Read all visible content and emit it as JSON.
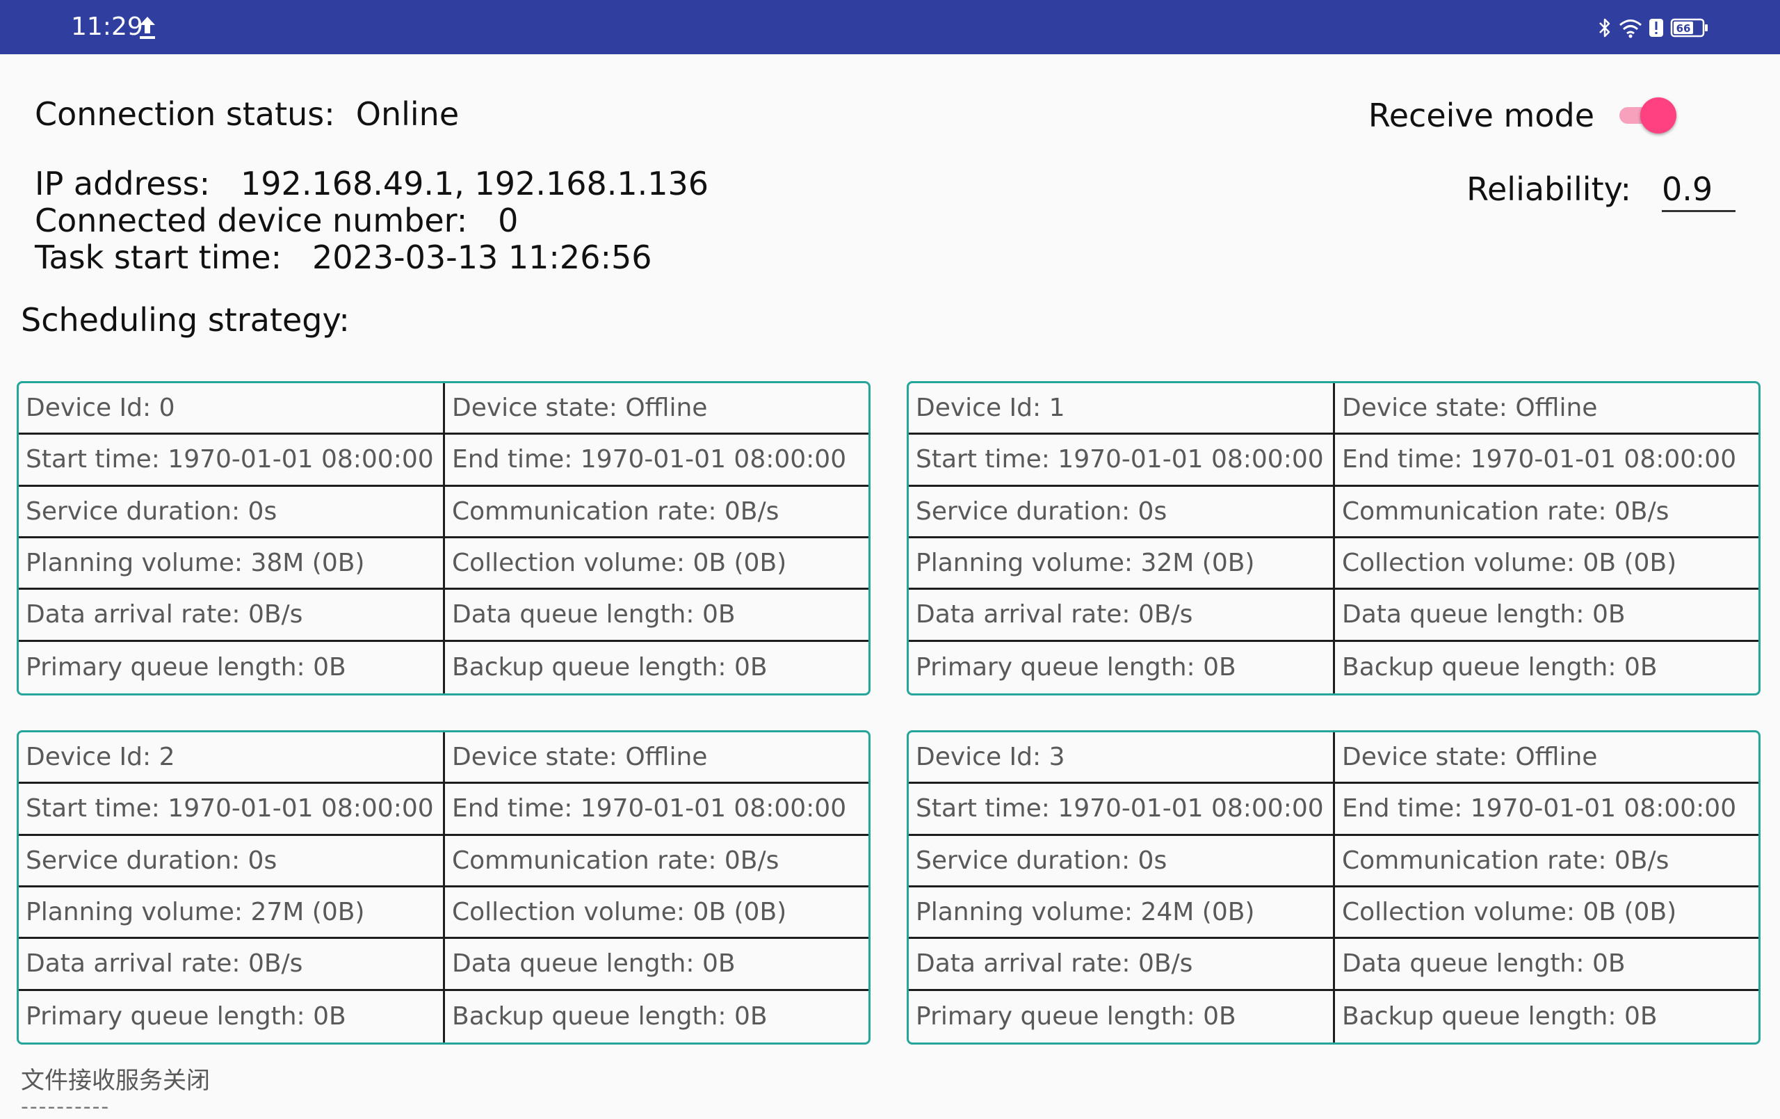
{
  "status_bar": {
    "time": "11:29",
    "battery_level": "66",
    "icons": [
      "upload-icon",
      "bluetooth-icon",
      "wifi-icon",
      "alert-icon",
      "battery-icon"
    ],
    "bg_color": "#303f9f"
  },
  "connection": {
    "label": "Connection status:",
    "value": "Online"
  },
  "info": {
    "ip_line": "IP address:   192.168.49.1, 192.168.1.136",
    "device_count_line": "Connected device number:   0",
    "task_start_line": "Task start time:   2023-03-13 11:26:56"
  },
  "scheduling": {
    "title": "Scheduling strategy:"
  },
  "receive_mode": {
    "label": "Receive mode",
    "enabled": true,
    "accent_color": "#ff4081"
  },
  "reliability": {
    "label": "Reliability:",
    "value": "0.9"
  },
  "tables": [
    {
      "cells": [
        [
          "Device Id: 0",
          "Device state: Offline"
        ],
        [
          "Start time: 1970-01-01 08:00:00",
          "End time: 1970-01-01 08:00:00"
        ],
        [
          "Service duration: 0s",
          "Communication rate: 0B/s"
        ],
        [
          "Planning volume: 38M (0B)",
          "Collection volume: 0B (0B)"
        ],
        [
          "Data arrival rate: 0B/s",
          "Data queue length: 0B"
        ],
        [
          "Primary queue length: 0B",
          "Backup queue length: 0B"
        ]
      ]
    },
    {
      "cells": [
        [
          "Device Id: 1",
          "Device state: Offline"
        ],
        [
          "Start time: 1970-01-01 08:00:00",
          "End time: 1970-01-01 08:00:00"
        ],
        [
          "Service duration: 0s",
          "Communication rate: 0B/s"
        ],
        [
          "Planning volume: 32M (0B)",
          "Collection volume: 0B (0B)"
        ],
        [
          "Data arrival rate: 0B/s",
          "Data queue length: 0B"
        ],
        [
          "Primary queue length: 0B",
          "Backup queue length: 0B"
        ]
      ]
    },
    {
      "cells": [
        [
          "Device Id: 2",
          "Device state: Offline"
        ],
        [
          "Start time: 1970-01-01 08:00:00",
          "End time: 1970-01-01 08:00:00"
        ],
        [
          "Service duration: 0s",
          "Communication rate: 0B/s"
        ],
        [
          "Planning volume: 27M (0B)",
          "Collection volume: 0B (0B)"
        ],
        [
          "Data arrival rate: 0B/s",
          "Data queue length: 0B"
        ],
        [
          "Primary queue length: 0B",
          "Backup queue length: 0B"
        ]
      ]
    },
    {
      "cells": [
        [
          "Device Id: 3",
          "Device state: Offline"
        ],
        [
          "Start time: 1970-01-01 08:00:00",
          "End time: 1970-01-01 08:00:00"
        ],
        [
          "Service duration: 0s",
          "Communication rate: 0B/s"
        ],
        [
          "Planning volume: 24M (0B)",
          "Collection volume: 0B (0B)"
        ],
        [
          "Data arrival rate: 0B/s",
          "Data queue length: 0B"
        ],
        [
          "Primary queue length: 0B",
          "Backup queue length: 0B"
        ]
      ]
    }
  ],
  "footer": {
    "message": "文件接收服务关闭",
    "divider": "----------"
  },
  "colors": {
    "table_border": "#26a69a",
    "toggle_track": "#f7a1bc"
  }
}
